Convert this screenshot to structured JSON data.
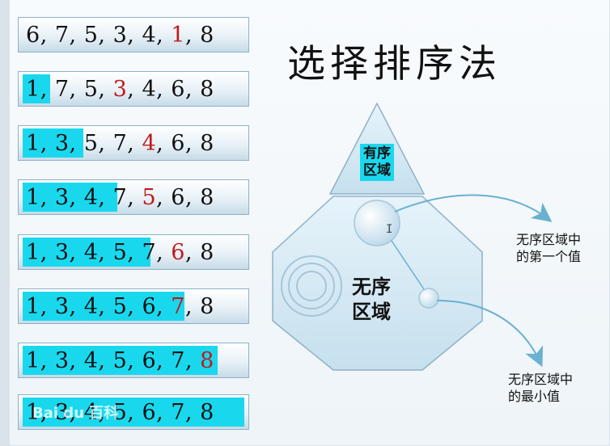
{
  "title": "选择排序法",
  "rows": [
    {
      "tokens": [
        "6",
        "7",
        "5",
        "3",
        "4",
        "1",
        "8"
      ],
      "sorted_count": 0,
      "red_index": 5
    },
    {
      "tokens": [
        "1",
        "7",
        "5",
        "3",
        "4",
        "6",
        "8"
      ],
      "sorted_count": 1,
      "red_index": 3
    },
    {
      "tokens": [
        "1",
        "3",
        "5",
        "7",
        "4",
        "6",
        "8"
      ],
      "sorted_count": 2,
      "red_index": 4
    },
    {
      "tokens": [
        "1",
        "3",
        "4",
        "7",
        "5",
        "6",
        "8"
      ],
      "sorted_count": 3,
      "red_index": 4
    },
    {
      "tokens": [
        "1",
        "3",
        "4",
        "5",
        "7",
        "6",
        "8"
      ],
      "sorted_count": 4,
      "red_index": 5
    },
    {
      "tokens": [
        "1",
        "3",
        "4",
        "5",
        "6",
        "7",
        "8"
      ],
      "sorted_count": 5,
      "red_index": 5
    },
    {
      "tokens": [
        "1",
        "3",
        "4",
        "5",
        "6",
        "7",
        "8"
      ],
      "sorted_count": 6,
      "red_index": 6
    },
    {
      "tokens": [
        "1",
        "3",
        "4",
        "5",
        "6",
        "7",
        "8"
      ],
      "sorted_count": 7,
      "red_index": -1
    }
  ],
  "diagram": {
    "sorted_region_label_line1": "有序",
    "sorted_region_label_line2": "区域",
    "unsorted_region_label_line1": "无序",
    "unsorted_region_label_line2": "区域",
    "first_value_label_line1": "无序区域中",
    "first_value_label_line2": "的第一个值",
    "min_value_label_line1": "无序区域中",
    "min_value_label_line2": "的最小值"
  },
  "watermark": "Bai du 百科",
  "colors": {
    "highlight": "#19d8ee",
    "swapped_value": "#c01a1a",
    "shape_fill": "#d6eaf5",
    "shape_border": "#8fb1c8",
    "arrow": "#6ab0d0"
  }
}
